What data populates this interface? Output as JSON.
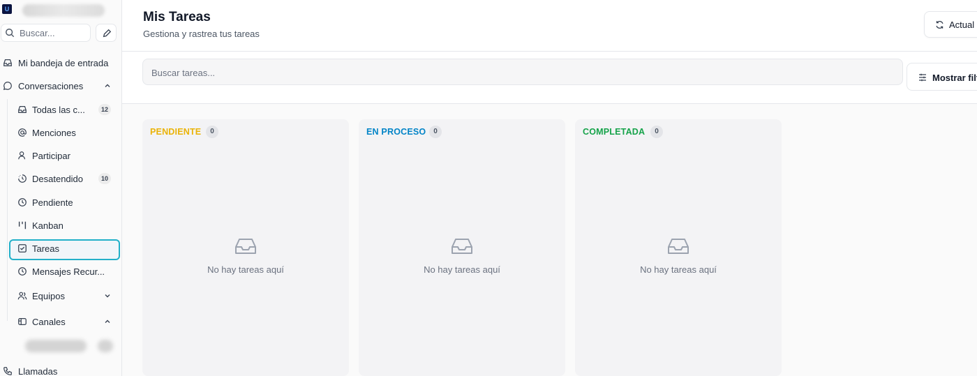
{
  "sidebar": {
    "logo_text": "U",
    "search_placeholder": "Buscar...",
    "items": [
      {
        "label": "Mi bandeja de entrada",
        "icon": "inbox-icon"
      },
      {
        "label": "Conversaciones",
        "icon": "chat-bubble-icon"
      },
      {
        "label": "Todas las c...",
        "icon": "inbox-icon",
        "badge": "12"
      },
      {
        "label": "Menciones",
        "icon": "at-icon"
      },
      {
        "label": "Participar",
        "icon": "user-icon"
      },
      {
        "label": "Desatendido",
        "icon": "clock-dashed-icon",
        "badge": "10"
      },
      {
        "label": "Pendiente",
        "icon": "clock-icon"
      },
      {
        "label": "Kanban",
        "icon": "kanban-icon"
      },
      {
        "label": "Tareas",
        "icon": "checkbox-icon",
        "active": true
      },
      {
        "label": "Mensajes Recur...",
        "icon": "clock-icon"
      },
      {
        "label": "Equipos",
        "icon": "users-icon"
      },
      {
        "label": "Canales",
        "icon": "channels-icon"
      },
      {
        "label": "Llamadas",
        "icon": "phone-icon"
      }
    ]
  },
  "header": {
    "title": "Mis Tareas",
    "subtitle": "Gestiona y rastrea tus tareas",
    "refresh_label": "Actual"
  },
  "toolbar": {
    "search_placeholder": "Buscar tareas...",
    "filters_label": "Mostrar filt"
  },
  "columns": [
    {
      "title": "PENDIENTE",
      "count": "0",
      "color": "#eab308",
      "empty": "No hay tareas aquí"
    },
    {
      "title": "EN PROCESO",
      "count": "0",
      "color": "#0284c7",
      "empty": "No hay tareas aquí"
    },
    {
      "title": "COMPLETADA",
      "count": "0",
      "color": "#16a34a",
      "empty": "No hay tareas aquí"
    }
  ],
  "colors": {
    "active_border": "#22b0c9",
    "pending": "#eab308",
    "in_progress": "#0284c7",
    "completed": "#16a34a"
  }
}
